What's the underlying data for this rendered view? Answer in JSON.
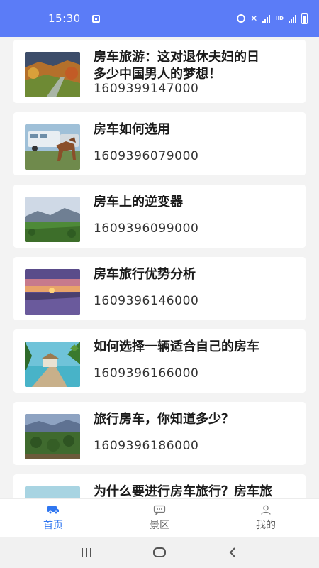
{
  "status_bar": {
    "time": "15:30",
    "right_icons": [
      "alarm-icon",
      "mute-icon",
      "signal-icon",
      "hd-icon",
      "wifi-signal-icon",
      "battery-icon"
    ],
    "hd_label": "HD",
    "background": "#5b7cf7"
  },
  "articles": [
    {
      "title": "房车旅游：这对退休夫妇的日\n多少中国男人的梦想！",
      "timestamp": "1609399147000",
      "thumb": "autumn-valley"
    },
    {
      "title": "房车如何选用",
      "timestamp": "1609396079000",
      "thumb": "rv-with-horses"
    },
    {
      "title": "房车上的逆变器",
      "timestamp": "1609396099000",
      "thumb": "mountain-meadow"
    },
    {
      "title": "房车旅行优势分析",
      "timestamp": "1609396146000",
      "thumb": "sunset-field"
    },
    {
      "title": "如何选择一辆适合自己的房车",
      "timestamp": "1609396166000",
      "thumb": "tropical-pier"
    },
    {
      "title": "旅行房车，你知道多少？",
      "timestamp": "1609396186000",
      "thumb": "forest-hills"
    },
    {
      "title": "为什么要进行房车旅行？房车旅",
      "timestamp": "",
      "thumb": "coast"
    }
  ],
  "tabs": [
    {
      "label": "首页",
      "icon": "rv-icon",
      "active": true
    },
    {
      "label": "景区",
      "icon": "chat-bubble-icon",
      "active": false
    },
    {
      "label": "我的",
      "icon": "person-icon",
      "active": false
    }
  ],
  "colors": {
    "accent": "#2f76f0",
    "inactive_tab": "#666666",
    "page_background": "#f3f3f3"
  }
}
